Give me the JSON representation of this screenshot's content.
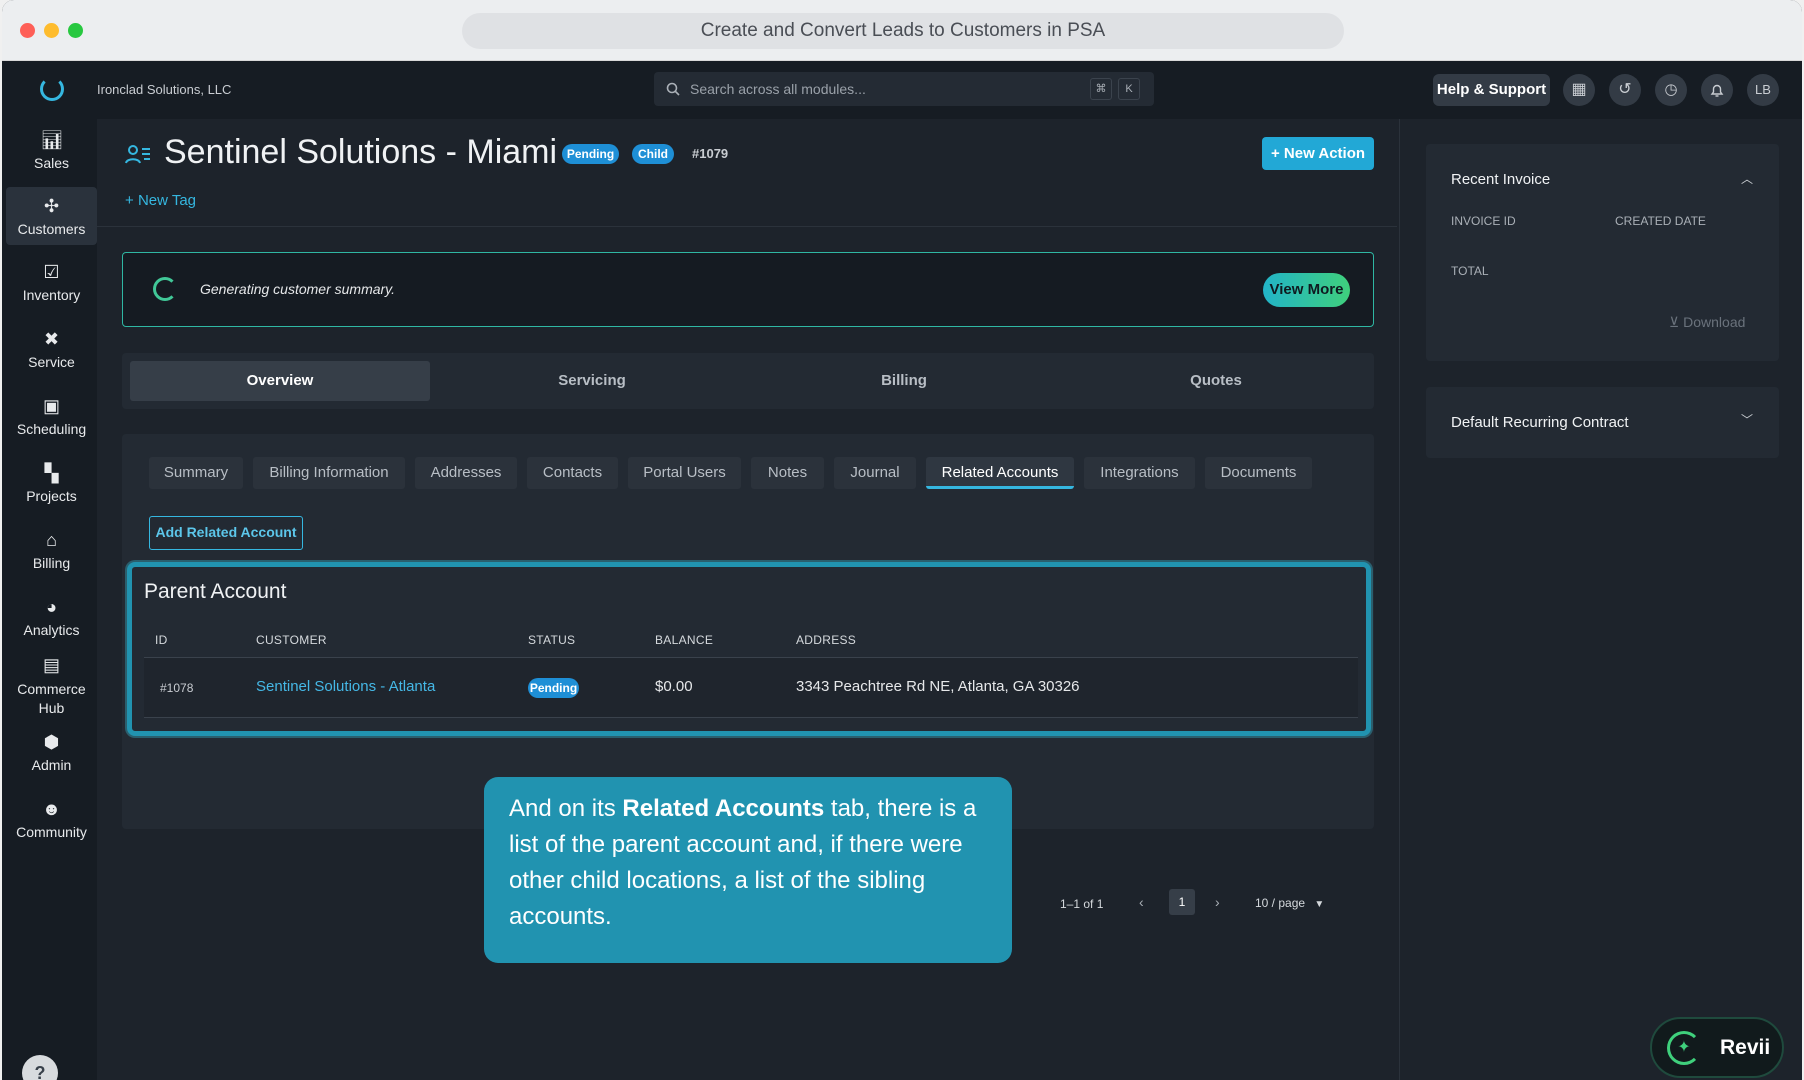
{
  "window": {
    "title": "Create and Convert Leads to Customers in PSA"
  },
  "topbar": {
    "org": "Ironclad Solutions, LLC",
    "search_placeholder": "Search across all modules...",
    "kbd1": "⌘",
    "kbd2": "K",
    "help": "Help & Support",
    "avatar": "LB"
  },
  "sidebar": {
    "items": [
      {
        "label": "Sales",
        "icon": "bar-chart-icon"
      },
      {
        "label": "Customers",
        "icon": "users-icon"
      },
      {
        "label": "Inventory",
        "icon": "clipboard-icon"
      },
      {
        "label": "Service",
        "icon": "tools-icon"
      },
      {
        "label": "Scheduling",
        "icon": "calendar-icon"
      },
      {
        "label": "Projects",
        "icon": "projects-icon"
      },
      {
        "label": "Billing",
        "icon": "bank-icon"
      },
      {
        "label": "Analytics",
        "icon": "pie-chart-icon"
      },
      {
        "label": "Commerce Hub",
        "icon": "store-icon"
      },
      {
        "label": "Admin",
        "icon": "admin-icon"
      },
      {
        "label": "Community",
        "icon": "community-icon"
      }
    ],
    "help_icon": "?"
  },
  "header": {
    "title": "Sentinel Solutions - Miami",
    "badge_pending": "Pending",
    "badge_child": "Child",
    "id": "#1079",
    "new_tag": "New Tag",
    "new_action": "New Action"
  },
  "summary": {
    "text": "Generating customer summary.",
    "view_more": "View More"
  },
  "main_tabs": [
    "Overview",
    "Servicing",
    "Billing",
    "Quotes"
  ],
  "sub_tabs": [
    "Summary",
    "Billing Information",
    "Addresses",
    "Contacts",
    "Portal Users",
    "Notes",
    "Journal",
    "Related Accounts",
    "Integrations",
    "Documents"
  ],
  "add_related": "Add Related Account",
  "parent": {
    "title": "Parent Account",
    "columns": [
      "ID",
      "CUSTOMER",
      "STATUS",
      "BALANCE",
      "ADDRESS"
    ],
    "row": {
      "id": "#1078",
      "customer": "Sentinel Solutions - Atlanta",
      "status": "Pending",
      "balance": "$0.00",
      "address": "3343 Peachtree Rd NE, Atlanta, GA 30326"
    }
  },
  "pagination": {
    "range": "1–1 of 1",
    "page": "1",
    "per_page": "10 / page"
  },
  "tooltip": {
    "pre": "And on its ",
    "bold": "Related Accounts",
    "post": " tab, there is a list of the parent account and, if there were other child locations, a list of the sibling accounts."
  },
  "right": {
    "recent_invoice": "Recent Invoice",
    "invoice_id": "INVOICE ID",
    "created_date": "CREATED DATE",
    "total": "TOTAL",
    "download": "Download",
    "default_contract": "Default Recurring Contract"
  },
  "revii": "Revii"
}
